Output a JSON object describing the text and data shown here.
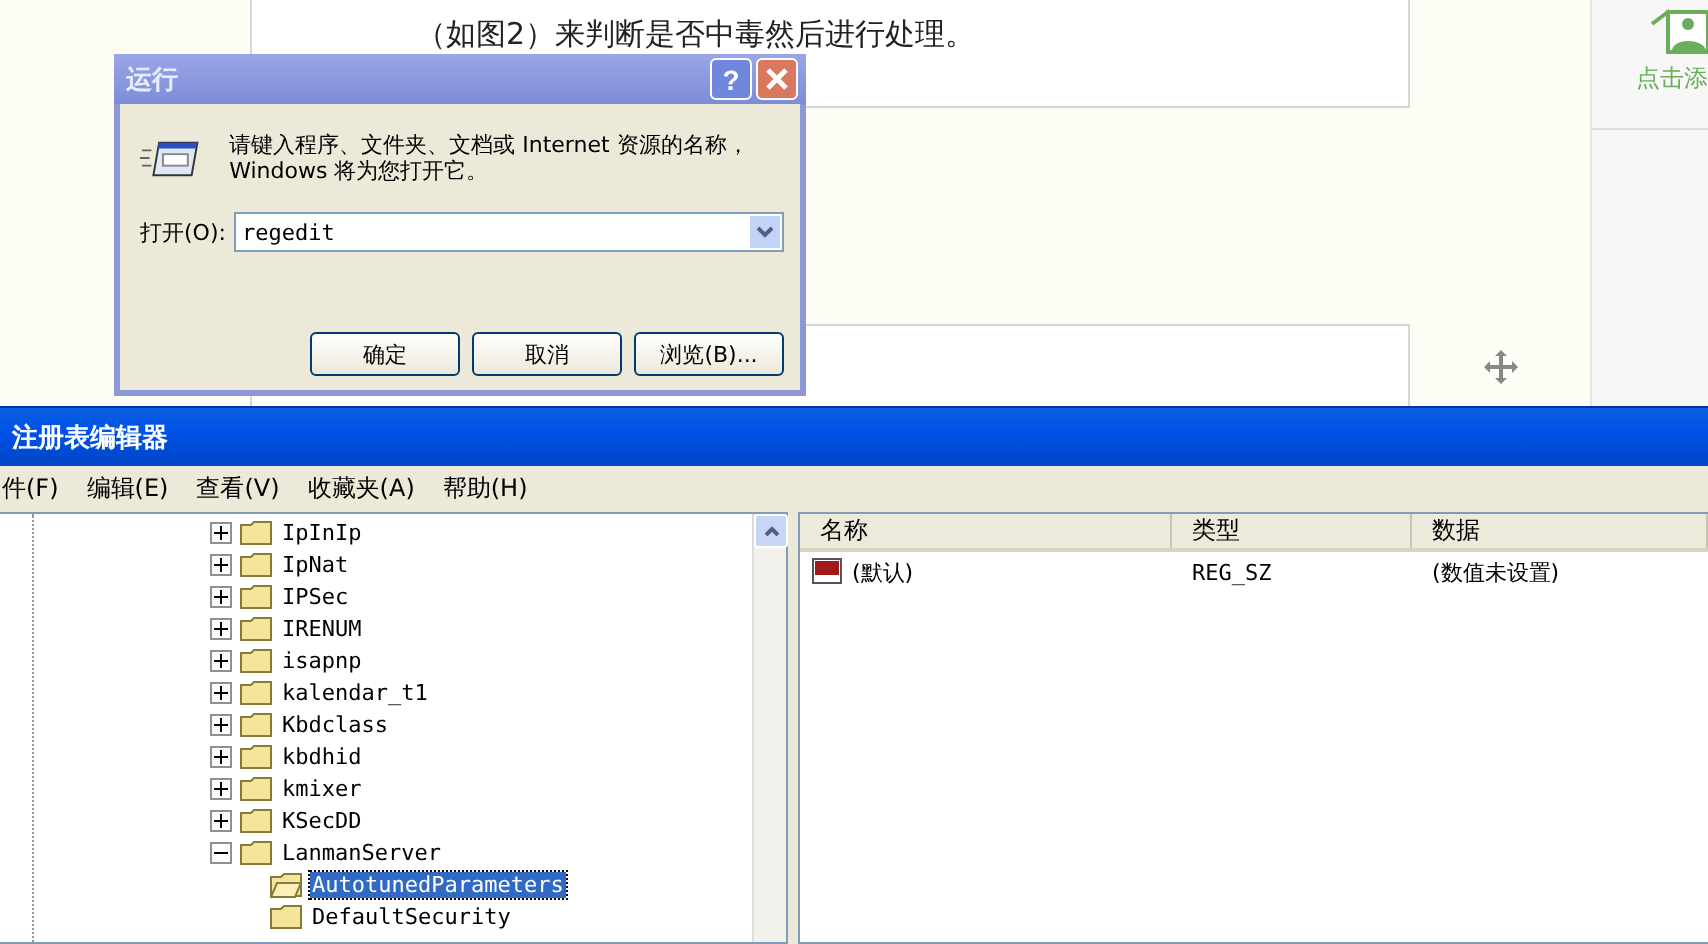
{
  "article": {
    "paragraphs": [
      "（如图2）来判断是否中毒然后进行处理。"
    ]
  },
  "sidebar": {
    "add_label": "点击添"
  },
  "run_dialog": {
    "title": "运行",
    "help_button": "?",
    "prompt": "请键入程序、文件夹、文档或 Internet 资源的名称，Windows 将为您打开它。",
    "open_label": "打开(O):",
    "open_value": "regedit",
    "buttons": [
      "确定",
      "取消",
      "浏览(B)..."
    ]
  },
  "regedit": {
    "title": "注册表编辑器",
    "menu": [
      "件(F)",
      "编辑(E)",
      "查看(V)",
      "收藏夹(A)",
      "帮助(H)"
    ],
    "tree": [
      {
        "label": "IpInIp",
        "expanded": false,
        "selected": false
      },
      {
        "label": "IpNat",
        "expanded": false,
        "selected": false
      },
      {
        "label": "IPSec",
        "expanded": false,
        "selected": false
      },
      {
        "label": "IRENUM",
        "expanded": false,
        "selected": false
      },
      {
        "label": "isapnp",
        "expanded": false,
        "selected": false
      },
      {
        "label": "kalendar_t1",
        "expanded": false,
        "selected": false
      },
      {
        "label": "Kbdclass",
        "expanded": false,
        "selected": false
      },
      {
        "label": "kbdhid",
        "expanded": false,
        "selected": false
      },
      {
        "label": "kmixer",
        "expanded": false,
        "selected": false
      },
      {
        "label": "KSecDD",
        "expanded": false,
        "selected": false
      },
      {
        "label": "LanmanServer",
        "expanded": true,
        "selected": false,
        "children": [
          {
            "label": "AutotunedParameters",
            "selected": true
          },
          {
            "label": "DefaultSecurity",
            "selected": false
          }
        ]
      }
    ],
    "columns": [
      "名称",
      "类型",
      "数据"
    ],
    "rows": [
      {
        "name": "(默认)",
        "type": "REG_SZ",
        "data": "(数值未设置)"
      }
    ]
  }
}
